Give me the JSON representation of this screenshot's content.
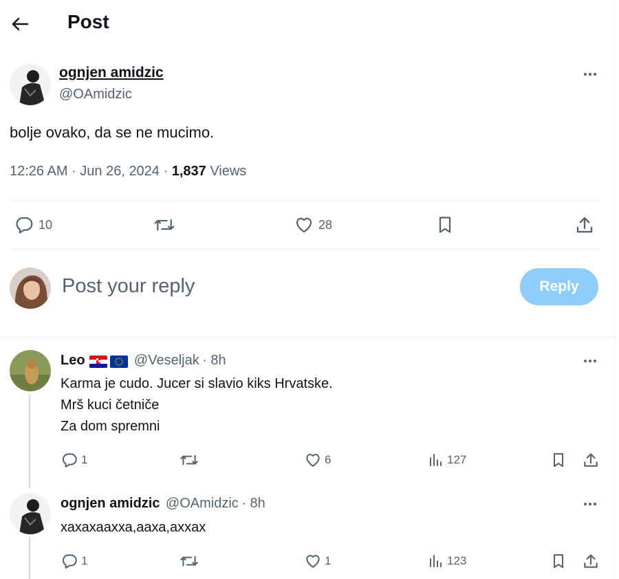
{
  "header": {
    "title": "Post"
  },
  "post": {
    "author_name": "ognjen amidzic",
    "author_handle": "@OAmidzic",
    "text": "bolje ovako, da se ne mucimo.",
    "time": "12:26 AM · Jun 26, 2024 · ",
    "views_count": "1,837",
    "views_label": " Views",
    "replies": "10",
    "likes": "28"
  },
  "compose": {
    "placeholder": "Post your reply",
    "button": "Reply"
  },
  "replies": [
    {
      "name": "Leo",
      "handle": "@Veseljak",
      "time": "· 8h",
      "lines": [
        "Karma je cudo. Jucer si slavio kiks Hrvatske.",
        "Mrš kuci četniče",
        "Za dom spremni"
      ],
      "replies": "1",
      "likes": "6",
      "views": "127"
    },
    {
      "name": "ognjen amidzic",
      "handle": "@OAmidzic",
      "time": "· 8h",
      "lines": [
        "хахахааxха,ааха,ахxах"
      ],
      "replies": "1",
      "likes": "1",
      "views": "123"
    }
  ],
  "icons": [
    "back-arrow-icon",
    "more-icon",
    "reply-icon",
    "retweet-icon",
    "like-icon",
    "bookmark-icon",
    "share-icon",
    "views-icon",
    "croatia-flag-icon",
    "eu-flag-icon"
  ],
  "colors": {
    "accent_disabled": "#8ecdf8",
    "secondary_text": "#536471",
    "divider": "#eff3f4"
  }
}
